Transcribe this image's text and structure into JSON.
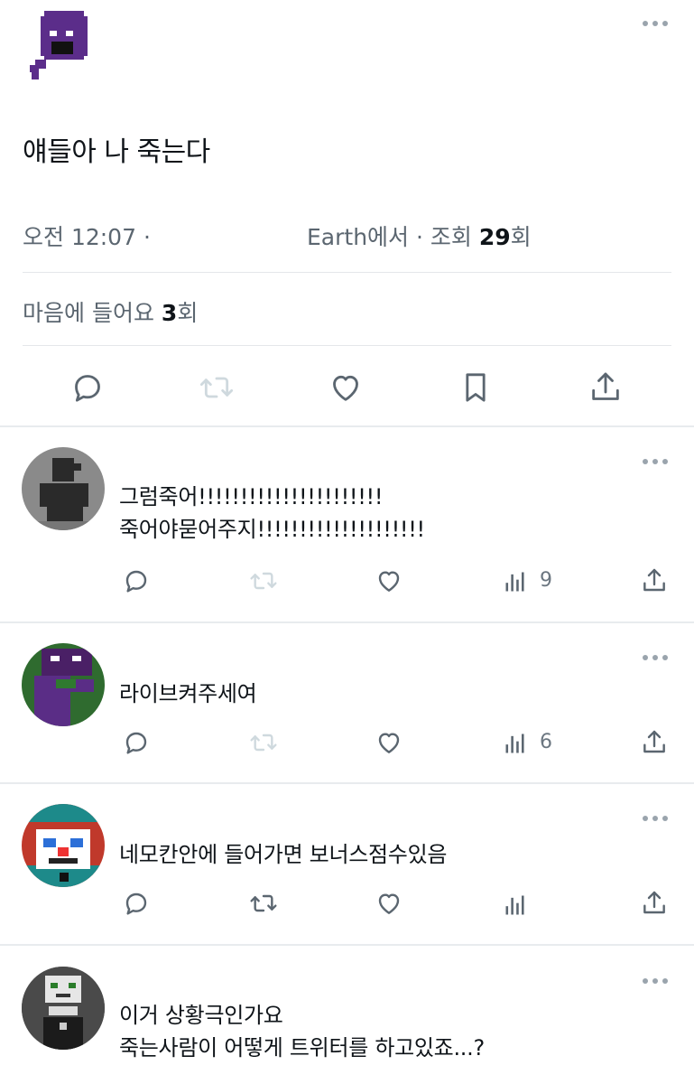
{
  "tweet": {
    "text": "얘들아 나 죽는다",
    "time": "오전 12:07 ·",
    "location_views": "Earth에서 · 조회 ",
    "views_count": "29",
    "views_unit": "회",
    "likes_label": "마음에 들어요 ",
    "likes_count": "3",
    "likes_unit": "회"
  },
  "replies": [
    {
      "line1": "그럼죽어!!!!!!!!!!!!!!!!!!!!!!",
      "line2": "죽어야묻어주지!!!!!!!!!!!!!!!!!!!!",
      "views": "9"
    },
    {
      "line1": "라이브켜주세여",
      "line2": "",
      "views": "6"
    },
    {
      "line1": "네모칸안에 들어가면 보너스점수있음",
      "line2": "",
      "views": ""
    },
    {
      "line1": "이거 상황극인가요",
      "line2": "죽는사람이 어떻게 트위터를 하고있죠...?",
      "views": ""
    }
  ],
  "colors": {
    "icon_gray": "#5b6670",
    "faded_icon": "#cfd9de",
    "text": "#0f1419",
    "accent_purple": "#5a2d86"
  },
  "icons": [
    "more-icon",
    "reply-icon",
    "retweet-icon",
    "like-icon",
    "bookmark-icon",
    "share-icon",
    "views-icon"
  ]
}
